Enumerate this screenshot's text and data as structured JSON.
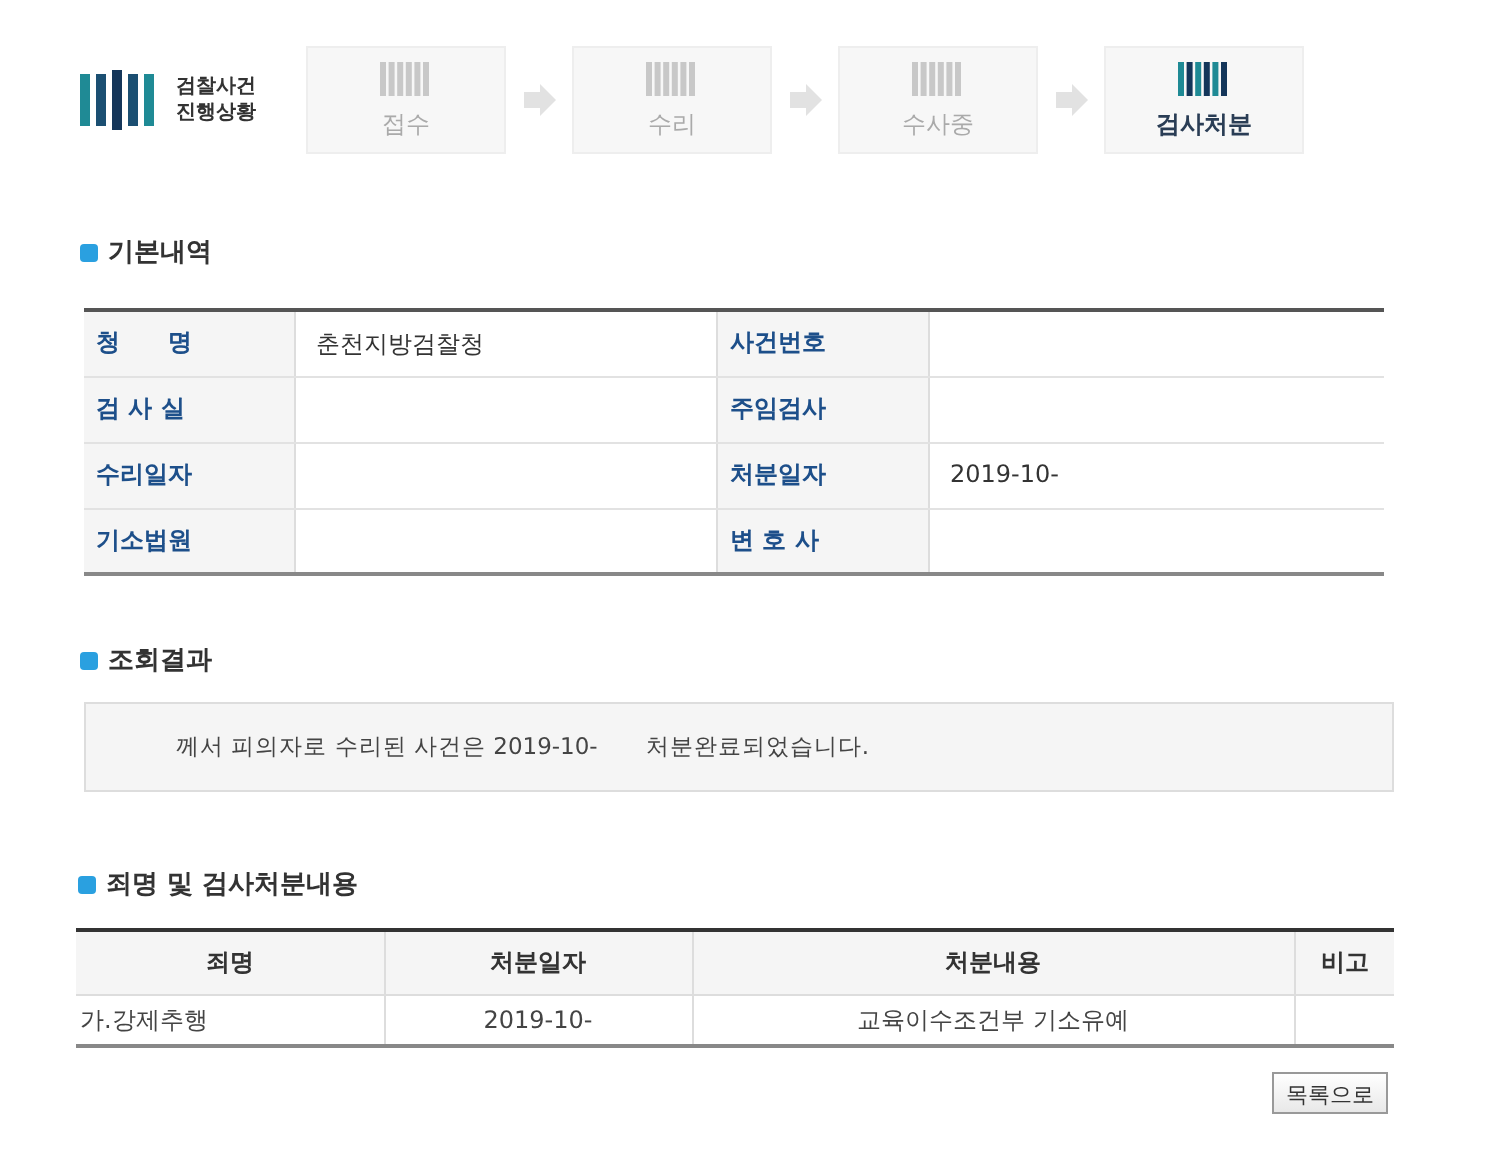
{
  "logo": {
    "line1": "검찰사건",
    "line2": "진행상황"
  },
  "steps": [
    {
      "label": "접수",
      "selected": false
    },
    {
      "label": "수리",
      "selected": false
    },
    {
      "label": "수사중",
      "selected": false
    },
    {
      "label": "검사처분",
      "selected": true
    }
  ],
  "basic": {
    "title": "기본내역",
    "rows": [
      {
        "label1": "청　　명",
        "value1": "춘천지방검찰청",
        "label2": "사건번호",
        "value2": ""
      },
      {
        "label1": "검 사 실",
        "value1": "",
        "label2": "주임검사",
        "value2": ""
      },
      {
        "label1": "수리일자",
        "value1": "",
        "label2": "처분일자",
        "value2": "2019-10-"
      },
      {
        "label1": "기소법원",
        "value1": "",
        "label2": "변 호 사",
        "value2": ""
      }
    ]
  },
  "result": {
    "title": "조회결과",
    "message": "께서 피의자로 수리된 사건은 2019-10-　　처분완료되었습니다."
  },
  "charges": {
    "title": "죄명 및 검사처분내용",
    "columns": [
      "죄명",
      "처분일자",
      "처분내용",
      "비고"
    ],
    "rows": [
      [
        "가.강제추행",
        "2019-10-",
        "교육이수조건부 기소유예",
        ""
      ]
    ]
  },
  "buttons": [
    "목록으로"
  ]
}
